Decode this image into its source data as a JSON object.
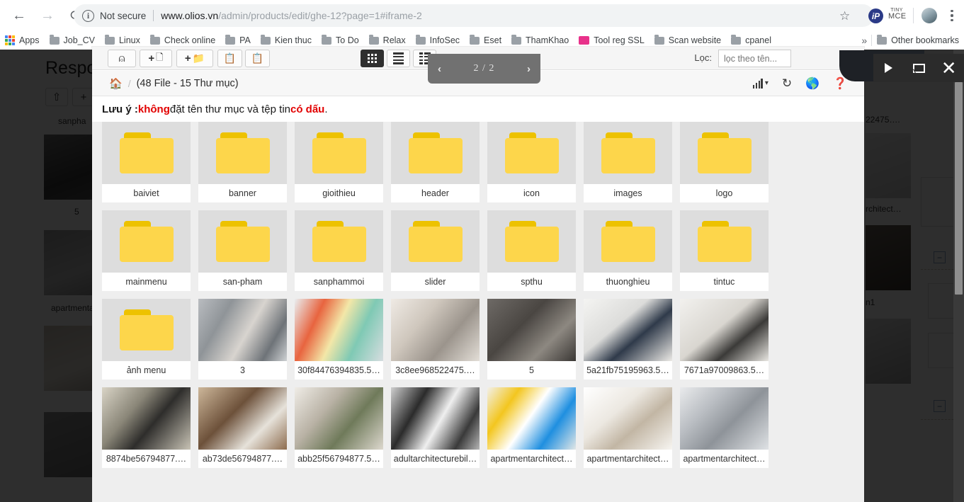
{
  "browser": {
    "back_icon": "back-arrow-icon",
    "forward_icon": "forward-arrow-icon",
    "reload_icon": "reload-icon",
    "info_icon": "info-circle-icon",
    "security_label": "Not secure",
    "url_domain": "www.olios.vn",
    "url_path": "/admin/products/edit/ghe-12?page=1#iframe-2",
    "star_icon": "bookmark-star-icon",
    "ext_ip_label": "iP",
    "ext_tiny_line1": "TINY",
    "ext_tiny_line2": "MCE",
    "avatar_icon": "profile-avatar",
    "menu_icon": "kebab-menu-icon",
    "bookmarks": [
      {
        "label": "Apps",
        "icon": "apps-grid-icon"
      },
      {
        "label": "Job_CV",
        "icon": "folder-icon"
      },
      {
        "label": "Linux",
        "icon": "folder-icon"
      },
      {
        "label": "Check online",
        "icon": "folder-icon"
      },
      {
        "label": "PA",
        "icon": "folder-icon"
      },
      {
        "label": "Kien thuc",
        "icon": "folder-icon"
      },
      {
        "label": "To Do",
        "icon": "folder-icon"
      },
      {
        "label": "Relax",
        "icon": "folder-icon"
      },
      {
        "label": "InfoSec",
        "icon": "folder-icon"
      },
      {
        "label": "Eset",
        "icon": "folder-icon"
      },
      {
        "label": "ThamKhao",
        "icon": "folder-icon"
      },
      {
        "label": "Tool reg SSL",
        "icon": "ssl-tool-icon"
      },
      {
        "label": "Scan website",
        "icon": "folder-icon"
      },
      {
        "label": "cpanel",
        "icon": "folder-icon"
      }
    ],
    "overflow_label": "»",
    "other_bookmarks_label": "Other bookmarks"
  },
  "filemanager": {
    "toolbar": {
      "upload_label": "upload-icon",
      "new_file_label": "new-file-icon",
      "new_folder_label": "new-folder-icon",
      "clipboard_copy_label": "clipboard-check-icon",
      "clipboard_clear_label": "clipboard-clear-icon",
      "view_grid_label": "grid-view-icon",
      "view_list_label": "list-view-icon",
      "view_detail_label": "detail-view-icon",
      "active_view": "grid",
      "filter_label": "Lọc:",
      "filter_placeholder": "lọc theo tên...",
      "filter_value": ""
    },
    "breadcrumb": {
      "home_icon": "home-icon",
      "separator": "/",
      "summary": "(48 File - 15 Thư mục)",
      "sort_icon": "sort-bars-icon",
      "sort_caret": "▾",
      "refresh_icon": "refresh-icon",
      "language_icon": "globe-icon",
      "help_icon": "help-circle-icon"
    },
    "notice": {
      "prefix": "Lưu ý : ",
      "highlight1": "không",
      "middle": " đặt tên thư mục và tệp tin ",
      "highlight2": "có dấu",
      "suffix": "."
    },
    "pagination": {
      "prev_icon": "chevron-left-icon",
      "page_text": "2 / 2",
      "next_icon": "chevron-right-icon"
    },
    "rows": [
      [
        {
          "name": "baiviet",
          "type": "folder"
        },
        {
          "name": "banner",
          "type": "folder"
        },
        {
          "name": "gioithieu",
          "type": "folder"
        },
        {
          "name": "header",
          "type": "folder"
        },
        {
          "name": "icon",
          "type": "folder"
        },
        {
          "name": "images",
          "type": "folder"
        },
        {
          "name": "logo",
          "type": "folder"
        }
      ],
      [
        {
          "name": "mainmenu",
          "type": "folder"
        },
        {
          "name": "san-pham",
          "type": "folder"
        },
        {
          "name": "sanphammoi",
          "type": "folder"
        },
        {
          "name": "slider",
          "type": "folder"
        },
        {
          "name": "spthu",
          "type": "folder"
        },
        {
          "name": "thuonghieu",
          "type": "folder"
        },
        {
          "name": "tintuc",
          "type": "folder"
        }
      ],
      [
        {
          "name": "ảnh menu",
          "type": "folder"
        },
        {
          "name": "3",
          "type": "image",
          "thumb": "bathroom"
        },
        {
          "name": "30f84476394835.5…",
          "type": "image",
          "thumb": "kitchen-red"
        },
        {
          "name": "3c8ee968522475.…",
          "type": "image",
          "thumb": "livingroom-grey"
        },
        {
          "name": "5",
          "type": "image",
          "thumb": "office-dark"
        },
        {
          "name": "5a21fb75195963.5…",
          "type": "image",
          "thumb": "shelf-white"
        },
        {
          "name": "7671a97009863.5…",
          "type": "image",
          "thumb": "loft-white"
        }
      ],
      [
        {
          "name": "8874be56794877.…",
          "type": "image",
          "thumb": "tv-room"
        },
        {
          "name": "ab73de56794877.…",
          "type": "image",
          "thumb": "flowers-table"
        },
        {
          "name": "abb25f56794877.5…",
          "type": "image",
          "thumb": "plant-sofa"
        },
        {
          "name": "adultarchitecturebil…",
          "type": "image",
          "thumb": "street-mural"
        },
        {
          "name": "apartmentarchitect…",
          "type": "image",
          "thumb": "blue-yellow-street"
        },
        {
          "name": "apartmentarchitect…",
          "type": "image",
          "thumb": "white-desk"
        },
        {
          "name": "apartmentarchitect…",
          "type": "image",
          "thumb": "glass-atrium"
        }
      ]
    ]
  },
  "window_controls": {
    "play_icon": "play-icon",
    "maximize_icon": "maximize-icon",
    "close_icon": "close-icon"
  },
  "backdrop": {
    "page_title": "Respon",
    "labels": [
      "sanpha",
      "5",
      "apartmenta",
      "22475….",
      "rchitect…",
      "n1"
    ]
  },
  "colors": {
    "folder_yellow": "#fdd64b",
    "folder_tab": "#edc200",
    "notice_red": "#e20000",
    "toolbar_bg": "#f5f5f5",
    "grid_bg": "#eeeeee",
    "active_btn": "#2f2f2f"
  }
}
